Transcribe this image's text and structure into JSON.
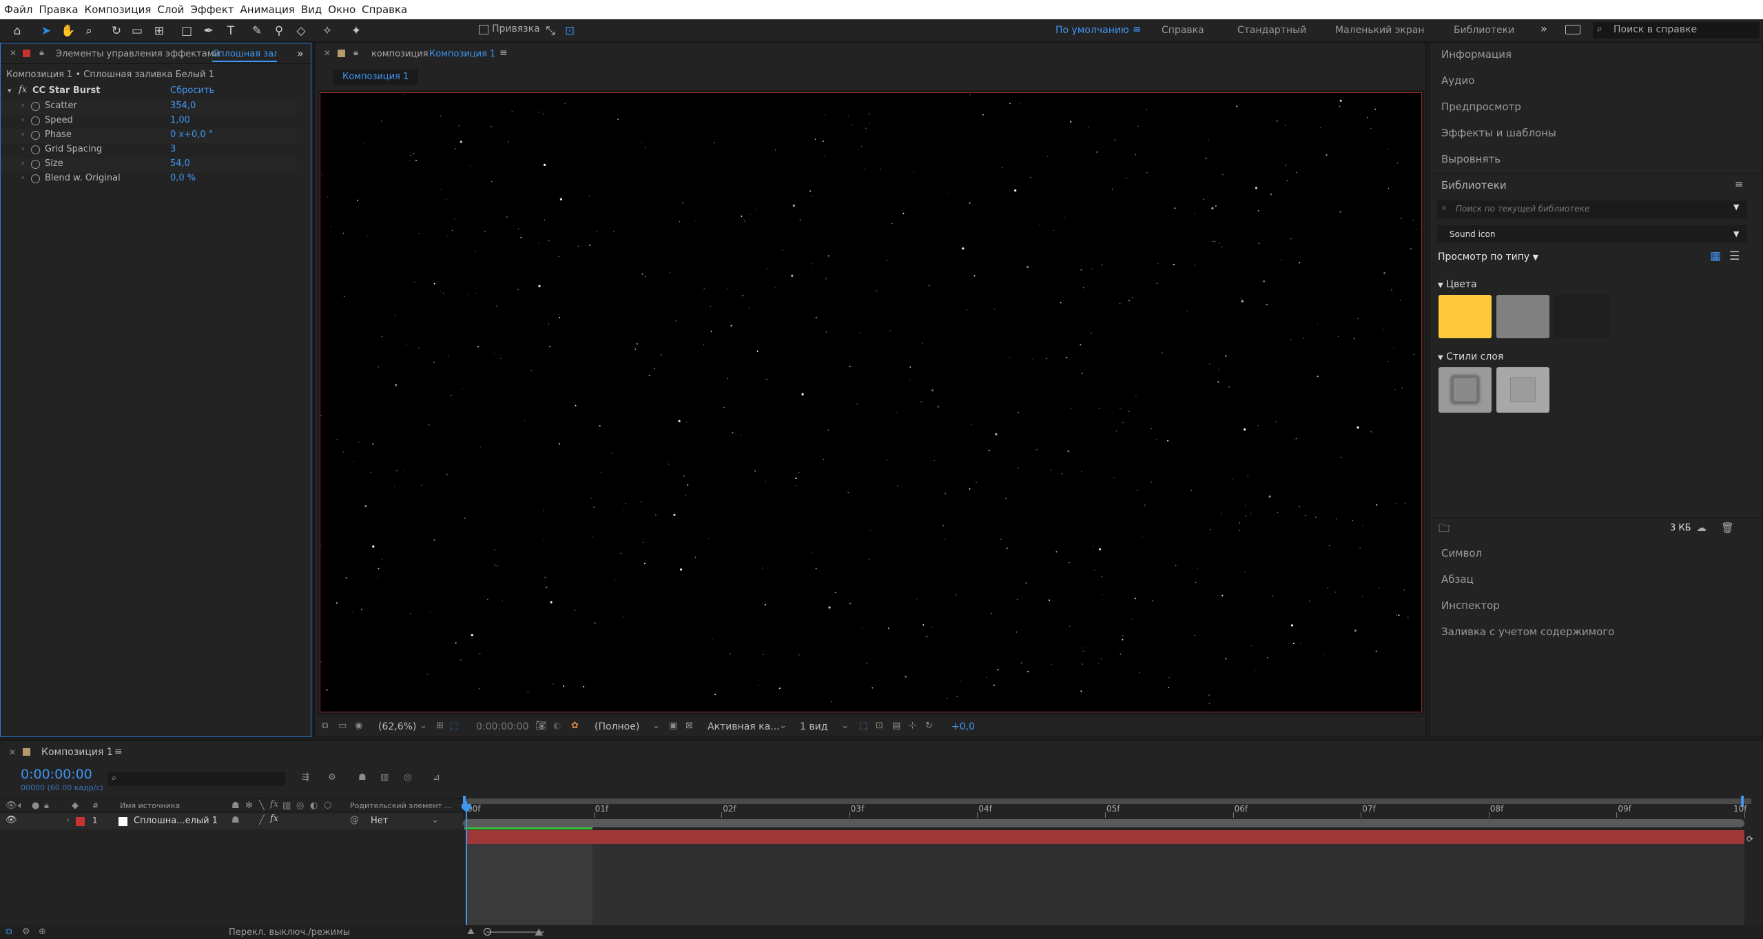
{
  "menu": [
    "Файл",
    "Правка",
    "Композиция",
    "Слой",
    "Эффект",
    "Анимация",
    "Вид",
    "Окно",
    "Справка"
  ],
  "toolbar": {
    "snap_label": "Привязка",
    "workspaces": [
      "По умолчанию",
      "Справка",
      "Стандартный",
      "Маленький экран",
      "Библиотеки"
    ],
    "active_workspace": "По умолчанию",
    "search_placeholder": "Поиск в справке"
  },
  "effects_panel": {
    "tab_label": "Элементы управления эффектами",
    "tab_layer": "Сплошная зали",
    "breadcrumb": "Композиция 1 • Сплошная заливка Белый 1",
    "effect_name": "CC Star Burst",
    "reset_label": "Сбросить",
    "fx_label": "fx",
    "properties": [
      {
        "name": "Scatter",
        "value": "354,0"
      },
      {
        "name": "Speed",
        "value": "1,00"
      },
      {
        "name": "Phase",
        "value": "0 x+0,0 °"
      },
      {
        "name": "Grid Spacing",
        "value": "3"
      },
      {
        "name": "Size",
        "value": "54,0"
      },
      {
        "name": "Blend w. Original",
        "value": "0,0 %"
      }
    ]
  },
  "comp_panel": {
    "tab_prefix": "композиция",
    "tab_name": "Композиция 1",
    "subtab": "Композиция 1",
    "footer": {
      "zoom": "(62,6%)",
      "timecode": "0:00:00:00",
      "resolution": "(Полное)",
      "camera": "Активная ка...",
      "views": "1 вид",
      "exposure": "+0,0"
    }
  },
  "right_panel": {
    "top_items": [
      "Информация",
      "Аудио",
      "Предпросмотр",
      "Эффекты и шаблоны",
      "Выровнять"
    ],
    "libraries_title": "Библиотеки",
    "library_search_placeholder": "Поиск по текущей библиотеке",
    "library_selected": "Sound icon",
    "view_by_type": "Просмотр по типу",
    "colors_header": "Цвета",
    "colors": [
      "#ffc83d",
      "#808080",
      "#1e1e1e"
    ],
    "styles_header": "Стили слоя",
    "size_label": "3 КБ",
    "bottom_items": [
      "Символ",
      "Абзац",
      "Инспектор",
      "Заливка с учетом содержимого"
    ]
  },
  "timeline": {
    "tab_name": "Композиция 1",
    "timecode": "0:00:00:00",
    "fps": "00000 (60.00 кадр/с)",
    "search_placeholder": "",
    "col_hash": "#",
    "col_source": "Имя источника",
    "col_parent": "Родительский элемент ...",
    "ruler": [
      "00f",
      "01f",
      "02f",
      "03f",
      "04f",
      "05f",
      "06f",
      "07f",
      "08f",
      "09f",
      "10f"
    ],
    "layer": {
      "index": "1",
      "name": "Сплошна...елый 1",
      "parent": "Нет",
      "label_color": "#c83232"
    },
    "status": "Перекл. выключ./режимы"
  }
}
